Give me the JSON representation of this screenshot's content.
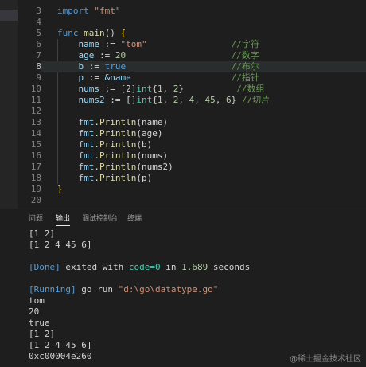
{
  "editor": {
    "line_numbers": [
      "3",
      "4",
      "5",
      "6",
      "7",
      "8",
      "9",
      "10",
      "11",
      "12",
      "13",
      "14",
      "15",
      "16",
      "17",
      "18",
      "19",
      "20"
    ],
    "lines": [
      {
        "n": "3",
        "tokens": [
          {
            "t": "import ",
            "c": "kw"
          },
          {
            "t": "\"fmt\"",
            "c": "str"
          }
        ]
      },
      {
        "n": "4",
        "tokens": []
      },
      {
        "n": "5",
        "tokens": [
          {
            "t": "func ",
            "c": "kw"
          },
          {
            "t": "main",
            "c": "fn"
          },
          {
            "t": "() ",
            "c": "op"
          },
          {
            "t": "{",
            "c": "brace"
          }
        ]
      },
      {
        "n": "6",
        "tokens": [
          {
            "t": "    name ",
            "c": "id"
          },
          {
            "t": ":= ",
            "c": "op"
          },
          {
            "t": "\"tom\"",
            "c": "str"
          },
          {
            "t": "                //字符",
            "c": "cm"
          }
        ]
      },
      {
        "n": "7",
        "tokens": [
          {
            "t": "    age ",
            "c": "id"
          },
          {
            "t": ":= ",
            "c": "op"
          },
          {
            "t": "20",
            "c": "num"
          },
          {
            "t": "                    //数字",
            "c": "cm"
          }
        ]
      },
      {
        "n": "8",
        "tokens": [
          {
            "t": "    b ",
            "c": "id"
          },
          {
            "t": ":= ",
            "c": "op"
          },
          {
            "t": "true",
            "c": "kw"
          },
          {
            "t": "                    //布尔",
            "c": "cm"
          }
        ]
      },
      {
        "n": "9",
        "tokens": [
          {
            "t": "    p ",
            "c": "id"
          },
          {
            "t": ":= ",
            "c": "op"
          },
          {
            "t": "&name",
            "c": "id"
          },
          {
            "t": "                   //指针",
            "c": "cm"
          }
        ]
      },
      {
        "n": "10",
        "tokens": [
          {
            "t": "    nums ",
            "c": "id"
          },
          {
            "t": ":= ",
            "c": "op"
          },
          {
            "t": "[2]",
            "c": "op"
          },
          {
            "t": "int",
            "c": "typ"
          },
          {
            "t": "{",
            "c": "op"
          },
          {
            "t": "1",
            "c": "num"
          },
          {
            "t": ", ",
            "c": "op"
          },
          {
            "t": "2",
            "c": "num"
          },
          {
            "t": "}",
            "c": "op"
          },
          {
            "t": "          //数组",
            "c": "cm"
          }
        ]
      },
      {
        "n": "11",
        "tokens": [
          {
            "t": "    nums2 ",
            "c": "id"
          },
          {
            "t": ":= ",
            "c": "op"
          },
          {
            "t": "[]",
            "c": "op"
          },
          {
            "t": "int",
            "c": "typ"
          },
          {
            "t": "{",
            "c": "op"
          },
          {
            "t": "1",
            "c": "num"
          },
          {
            "t": ", ",
            "c": "op"
          },
          {
            "t": "2",
            "c": "num"
          },
          {
            "t": ", ",
            "c": "op"
          },
          {
            "t": "4",
            "c": "num"
          },
          {
            "t": ", ",
            "c": "op"
          },
          {
            "t": "45",
            "c": "num"
          },
          {
            "t": ", ",
            "c": "op"
          },
          {
            "t": "6",
            "c": "num"
          },
          {
            "t": "} ",
            "c": "op"
          },
          {
            "t": "//切片",
            "c": "cm"
          }
        ]
      },
      {
        "n": "12",
        "tokens": []
      },
      {
        "n": "13",
        "tokens": [
          {
            "t": "    fmt",
            "c": "id"
          },
          {
            "t": ".",
            "c": "op"
          },
          {
            "t": "Println",
            "c": "fn"
          },
          {
            "t": "(name)",
            "c": "op"
          }
        ]
      },
      {
        "n": "14",
        "tokens": [
          {
            "t": "    fmt",
            "c": "id"
          },
          {
            "t": ".",
            "c": "op"
          },
          {
            "t": "Println",
            "c": "fn"
          },
          {
            "t": "(age)",
            "c": "op"
          }
        ]
      },
      {
        "n": "15",
        "tokens": [
          {
            "t": "    fmt",
            "c": "id"
          },
          {
            "t": ".",
            "c": "op"
          },
          {
            "t": "Println",
            "c": "fn"
          },
          {
            "t": "(b)",
            "c": "op"
          }
        ]
      },
      {
        "n": "16",
        "tokens": [
          {
            "t": "    fmt",
            "c": "id"
          },
          {
            "t": ".",
            "c": "op"
          },
          {
            "t": "Println",
            "c": "fn"
          },
          {
            "t": "(nums)",
            "c": "op"
          }
        ]
      },
      {
        "n": "17",
        "tokens": [
          {
            "t": "    fmt",
            "c": "id"
          },
          {
            "t": ".",
            "c": "op"
          },
          {
            "t": "Println",
            "c": "fn"
          },
          {
            "t": "(nums2)",
            "c": "op"
          }
        ]
      },
      {
        "n": "18",
        "tokens": [
          {
            "t": "    fmt",
            "c": "id"
          },
          {
            "t": ".",
            "c": "op"
          },
          {
            "t": "Println",
            "c": "fn"
          },
          {
            "t": "(p)",
            "c": "op"
          }
        ]
      },
      {
        "n": "19",
        "tokens": [
          {
            "t": "}",
            "c": "brace"
          }
        ]
      },
      {
        "n": "20",
        "tokens": []
      }
    ]
  },
  "panel": {
    "tabs": [
      "问题",
      "输出",
      "调试控制台",
      "终端"
    ],
    "active_tab": "输出",
    "output": {
      "line1": "[1 2]",
      "line2": "[1 2 4 45 6]",
      "done_tag": "[Done]",
      "done_text_a": " exited with ",
      "done_code": "code=0",
      "done_text_b": " in ",
      "done_secs": "1.689",
      "done_text_c": " seconds",
      "running_tag": "[Running]",
      "running_text": " go run ",
      "running_path": "\"d:\\go\\datatype.go\"",
      "results": [
        "tom",
        "20",
        "true",
        "[1 2]",
        "[1 2 4 45 6]",
        "0xc00004e260"
      ]
    }
  },
  "watermark": "@稀土掘金技术社区"
}
